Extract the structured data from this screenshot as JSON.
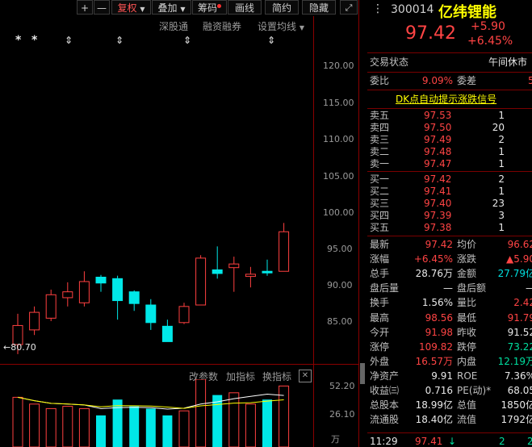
{
  "toolbar": {
    "add_label": "+",
    "minus_label": "—",
    "fuquan_label": "复权",
    "diejia_label": "叠加",
    "chouma_label": "筹码",
    "huaxian_label": "画线",
    "jianyue_label": "简约",
    "yincang_label": "隐藏"
  },
  "chart_header": {
    "shengutong": "深股通",
    "rongzi": "融资融券",
    "shezhi": "设置均线"
  },
  "markers": [
    "*",
    "*",
    "⇕",
    "⇕",
    "⇕",
    "⇕"
  ],
  "price_axis": [
    "120.00",
    "115.00",
    "110.00",
    "105.00",
    "100.00",
    "95.00",
    "90.00",
    "85.00"
  ],
  "low_label": "80.70",
  "indicator_bar": {
    "gaicanshu": "改参数",
    "jiazhibiao": "加指标",
    "huanzhibiao": "换指标",
    "close_label": "✕"
  },
  "volume_axis": [
    "52.20",
    "26.10",
    "万"
  ],
  "chart_data": {
    "type": "candlestick",
    "ylim": [
      78.5,
      124.5
    ],
    "candles": [
      {
        "o": 82.0,
        "c": 84.6,
        "h": 86.2,
        "l": 80.7,
        "up": true
      },
      {
        "o": 84.0,
        "c": 86.4,
        "h": 87.2,
        "l": 83.3,
        "up": true
      },
      {
        "o": 85.6,
        "c": 88.8,
        "h": 89.5,
        "l": 85.2,
        "up": true
      },
      {
        "o": 88.4,
        "c": 89.2,
        "h": 90.5,
        "l": 87.2,
        "up": true
      },
      {
        "o": 87.7,
        "c": 90.6,
        "h": 92.0,
        "l": 87.2,
        "up": true
      },
      {
        "o": 91.2,
        "c": 90.4,
        "h": 91.5,
        "l": 89.2,
        "up": false
      },
      {
        "o": 91.0,
        "c": 88.0,
        "h": 91.4,
        "l": 85.4,
        "up": false
      },
      {
        "o": 89.2,
        "c": 87.6,
        "h": 89.4,
        "l": 86.6,
        "up": false
      },
      {
        "o": 87.4,
        "c": 85.0,
        "h": 88.2,
        "l": 84.0,
        "up": false
      },
      {
        "o": 84.5,
        "c": 82.4,
        "h": 85.4,
        "l": 82.4,
        "up": false
      },
      {
        "o": 85.0,
        "c": 87.2,
        "h": 87.7,
        "l": 84.8,
        "up": true
      },
      {
        "o": 87.4,
        "c": 93.8,
        "h": 94.2,
        "l": 87.4,
        "up": true
      },
      {
        "o": 92.2,
        "c": 91.7,
        "h": 95.4,
        "l": 91.0,
        "up": false
      },
      {
        "o": 92.5,
        "c": 93.0,
        "h": 94.0,
        "l": 89.2,
        "up": true
      },
      {
        "o": 91.6,
        "c": 91.3,
        "h": 92.6,
        "l": 89.8,
        "up": true
      },
      {
        "o": 92.0,
        "c": 91.8,
        "h": 93.6,
        "l": 91.4,
        "up": false
      },
      {
        "o": 92.0,
        "c": 97.4,
        "h": 98.6,
        "l": 92.0,
        "up": true
      }
    ],
    "volume": [
      {
        "v": 22,
        "up": true
      },
      {
        "v": 19,
        "up": true
      },
      {
        "v": 17,
        "up": true
      },
      {
        "v": 18,
        "up": true
      },
      {
        "v": 17,
        "up": true
      },
      {
        "v": 14,
        "up": false
      },
      {
        "v": 21,
        "up": false
      },
      {
        "v": 18,
        "up": false
      },
      {
        "v": 17,
        "up": false
      },
      {
        "v": 14,
        "up": false
      },
      {
        "v": 16,
        "up": true
      },
      {
        "v": 30,
        "up": true
      },
      {
        "v": 23,
        "up": false
      },
      {
        "v": 24,
        "up": true
      },
      {
        "v": 19,
        "up": true
      },
      {
        "v": 21,
        "up": false
      },
      {
        "v": 27,
        "up": true
      }
    ]
  },
  "stock": {
    "code": "300014",
    "name": "亿纬锂能",
    "price": "97.42",
    "change": "+5.90",
    "change_pct": "+6.45%"
  },
  "status": {
    "label": "交易状态",
    "value": "午间休市"
  },
  "weibi": {
    "label1": "委比",
    "value1": "9.09%",
    "label2": "委差",
    "value2": "5"
  },
  "dk_label": "DK点自动提示涨跌信号",
  "sells": [
    {
      "label": "卖五",
      "price": "97.53",
      "vol": "1"
    },
    {
      "label": "卖四",
      "price": "97.50",
      "vol": "20"
    },
    {
      "label": "卖三",
      "price": "97.49",
      "vol": "2"
    },
    {
      "label": "卖二",
      "price": "97.48",
      "vol": "1"
    },
    {
      "label": "卖一",
      "price": "97.47",
      "vol": "1"
    }
  ],
  "buys": [
    {
      "label": "买一",
      "price": "97.42",
      "vol": "2"
    },
    {
      "label": "买二",
      "price": "97.41",
      "vol": "1"
    },
    {
      "label": "买三",
      "price": "97.40",
      "vol": "23"
    },
    {
      "label": "买四",
      "price": "97.39",
      "vol": "3"
    },
    {
      "label": "买五",
      "price": "97.38",
      "vol": "1"
    }
  ],
  "stats": [
    {
      "l1": "最新",
      "v1": "97.42",
      "c1": "red",
      "l2": "均价",
      "v2": "96.62",
      "c2": "red"
    },
    {
      "l1": "涨幅",
      "v1": "+6.45%",
      "c1": "red",
      "l2": "涨跌",
      "v2": "▲5.90",
      "c2": "red"
    },
    {
      "l1": "总手",
      "v1": "28.76万",
      "c1": "white",
      "l2": "金额",
      "v2": "27.79亿",
      "c2": "cyan"
    },
    {
      "l1": "盘后量",
      "v1": "—",
      "c1": "white",
      "l2": "盘后额",
      "v2": "—",
      "c2": "white"
    },
    {
      "l1": "换手",
      "v1": "1.56%",
      "c1": "white",
      "l2": "量比",
      "v2": "2.42",
      "c2": "red"
    },
    {
      "l1": "最高",
      "v1": "98.56",
      "c1": "red",
      "l2": "最低",
      "v2": "91.79",
      "c2": "red"
    },
    {
      "l1": "今开",
      "v1": "91.98",
      "c1": "red",
      "l2": "昨收",
      "v2": "91.52",
      "c2": "white"
    },
    {
      "l1": "涨停",
      "v1": "109.82",
      "c1": "red",
      "l2": "跌停",
      "v2": "73.22",
      "c2": "green"
    },
    {
      "l1": "外盘",
      "v1": "16.57万",
      "c1": "red",
      "l2": "内盘",
      "v2": "12.19万",
      "c2": "green"
    },
    {
      "l1": "净资产",
      "v1": "9.91",
      "c1": "white",
      "l2": "ROE",
      "v2": "7.36%",
      "c2": "white"
    },
    {
      "l1": "收益㈢",
      "v1": "0.716",
      "c1": "white",
      "l2": "PE(动)*",
      "v2": "68.05",
      "c2": "white"
    },
    {
      "l1": "总股本",
      "v1": "18.99亿",
      "c1": "white",
      "l2": "总值",
      "v2": "1850亿",
      "c2": "white"
    },
    {
      "l1": "流通股",
      "v1": "18.40亿",
      "c1": "white",
      "l2": "流值",
      "v2": "1792亿",
      "c2": "white"
    }
  ],
  "tick": {
    "time": "11:29",
    "price": "97.41",
    "arrow": "↓",
    "vol": "2",
    "num": "2"
  }
}
